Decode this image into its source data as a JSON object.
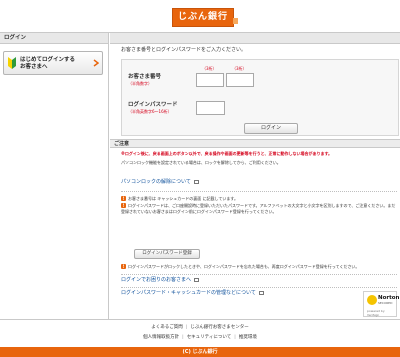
{
  "header": {
    "logo_text": "じぶん銀行"
  },
  "sidebar": {
    "title": "ログイン",
    "first_login_button": "はじめてログインする\nお客さまへ"
  },
  "main": {
    "instruction": "お客さま番号とログインパスワードをご入力ください。",
    "customer_number": {
      "label": "お客さま番号",
      "note": "（半角数字）",
      "caption_1": "（3桁）",
      "caption_2": "（3桁）"
    },
    "password": {
      "label": "ログインパスワード",
      "note": "（半角英数字6〜16桁）"
    },
    "login_button": "ログイン"
  },
  "notice": {
    "title": "ご注意",
    "warning": "※ログイン後に、戻る画面上のボタン以外で、戻る操作や画面の更新等を行うと、正常に動作しない場合があります。",
    "lock_info": "パソコンロック機能を設定されている場合は、ロックを解除してから、ご利用ください。",
    "pc_lock_link": "パソコンロックの解除について",
    "bullet1": "お客さま番号は キャッシュカードの裏面 に記載しています。",
    "bullet2": "ログインパスワードは、ご口座開設時に登録いただいたパスワードです。アルファベットの大文字と小文字を区別しますので、ご注意ください。まだ登録されていないお客さまはログイン前にログインパスワード登録を行ってください。",
    "pw_register_button": "ログインパスワード登録",
    "bullet3": "ログインパスワードがロックしたときや、ログインパスワードを忘れた場合も、再度ログインパスワード登録を行ってください。",
    "link_trouble": "ログインでお困りのお客さまへ",
    "link_manage": "ログインパスワード・キャッシュカードの管理などについて"
  },
  "badge": {
    "name": "Norton",
    "sub": "SECURED",
    "by": "powered by VeriSign"
  },
  "footer": {
    "faq": "よくあるご質問",
    "center": "じぶん銀行お客さまセンター",
    "privacy": "個人情報取扱方針",
    "security": "セキュリティについて",
    "env": "推奨環境",
    "copyright": "(C) じぶん銀行"
  },
  "colors": {
    "brand_orange": "#e8650d",
    "warning_red": "#d4001a",
    "link_blue": "#0b4e9a"
  }
}
